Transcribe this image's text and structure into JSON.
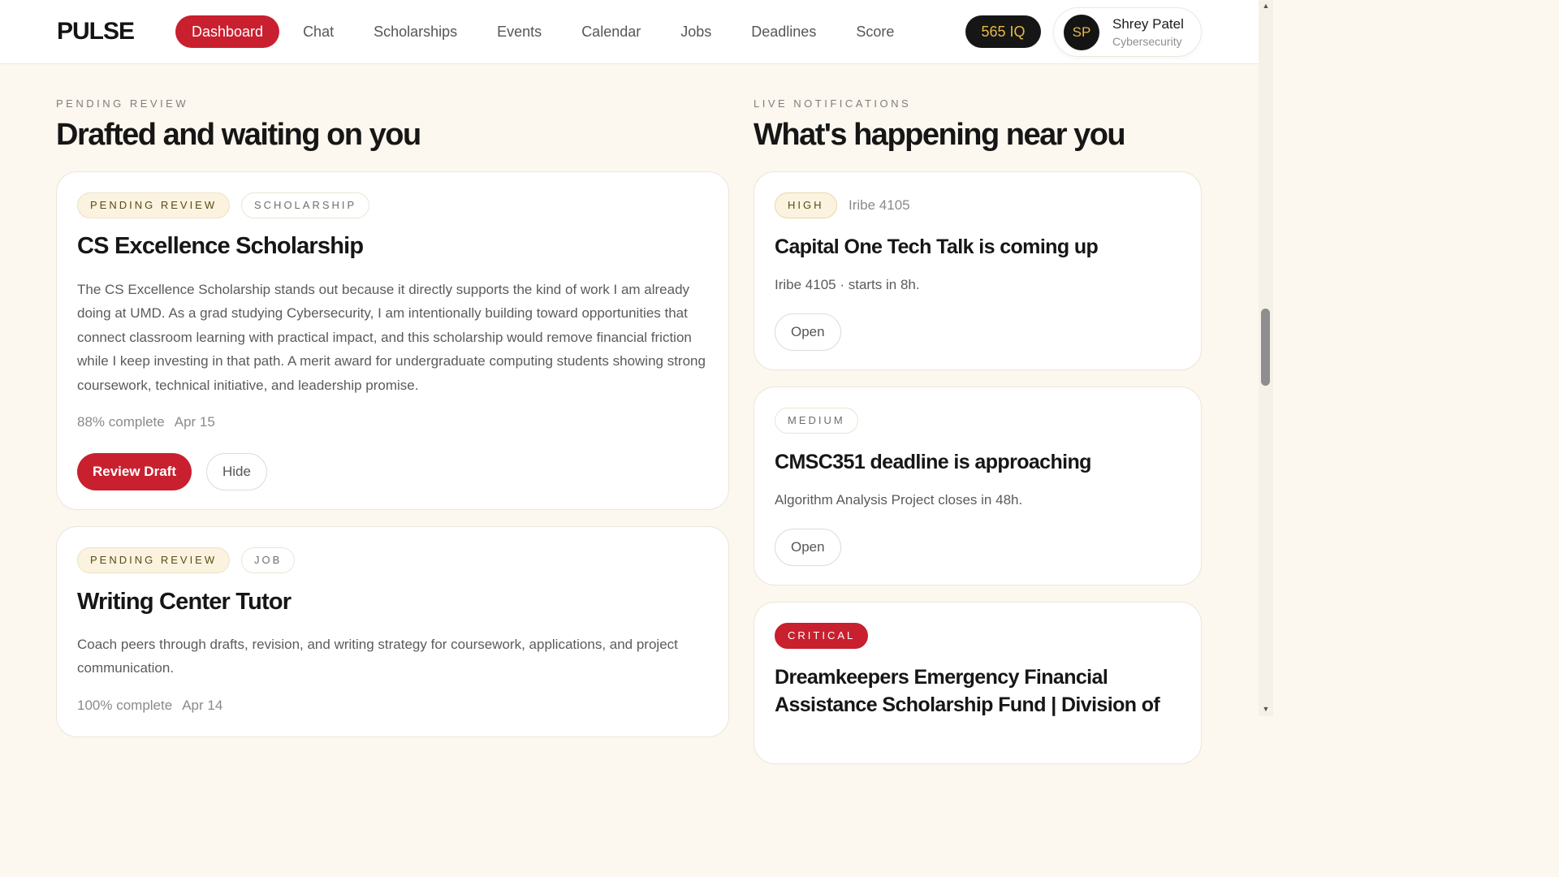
{
  "header": {
    "brand": "PULSE",
    "nav": [
      {
        "label": "Dashboard",
        "active": true
      },
      {
        "label": "Chat"
      },
      {
        "label": "Scholarships"
      },
      {
        "label": "Events"
      },
      {
        "label": "Calendar"
      },
      {
        "label": "Jobs"
      },
      {
        "label": "Deadlines"
      },
      {
        "label": "Score"
      }
    ],
    "iq": "565 IQ",
    "user": {
      "initials": "SP",
      "name": "Shrey Patel",
      "subtitle": "Cybersecurity"
    }
  },
  "pending": {
    "eyebrow": "PENDING REVIEW",
    "heading": "Drafted and waiting on you",
    "cards": [
      {
        "status_tag": "PENDING REVIEW",
        "type_tag": "SCHOLARSHIP",
        "title": "CS Excellence Scholarship",
        "body": "The CS Excellence Scholarship stands out because it directly supports the kind of work I am already doing at UMD. As a grad studying Cybersecurity, I am intentionally building toward opportunities that connect classroom learning with practical impact, and this scholarship would remove financial friction while I keep investing in that path. A merit award for undergraduate computing students showing strong coursework, technical initiative, and leadership promise.",
        "progress": "88% complete",
        "date": "Apr 15",
        "primary_action": "Review Draft",
        "secondary_action": "Hide"
      },
      {
        "status_tag": "PENDING REVIEW",
        "type_tag": "JOB",
        "title": "Writing Center Tutor",
        "body": "Coach peers through drafts, revision, and writing strategy for coursework, applications, and project communication.",
        "progress": "100% complete",
        "date": "Apr 14"
      }
    ]
  },
  "notifications": {
    "eyebrow": "LIVE NOTIFICATIONS",
    "heading": "What's happening near you",
    "items": [
      {
        "priority": "HIGH",
        "location": "Iribe 4105",
        "title": "Capital One Tech Talk is coming up",
        "detail": "Iribe 4105 · starts in 8h.",
        "action": "Open"
      },
      {
        "priority": "MEDIUM",
        "title": "CMSC351 deadline is approaching",
        "detail": "Algorithm Analysis Project closes in 48h.",
        "action": "Open"
      },
      {
        "priority": "CRITICAL",
        "title": "Dreamkeepers Emergency Financial Assistance Scholarship Fund | Division of"
      }
    ]
  },
  "colors": {
    "accent": "#c8202f",
    "background": "#fcf7ef",
    "dark": "#161616",
    "gold": "#e6b94a"
  }
}
